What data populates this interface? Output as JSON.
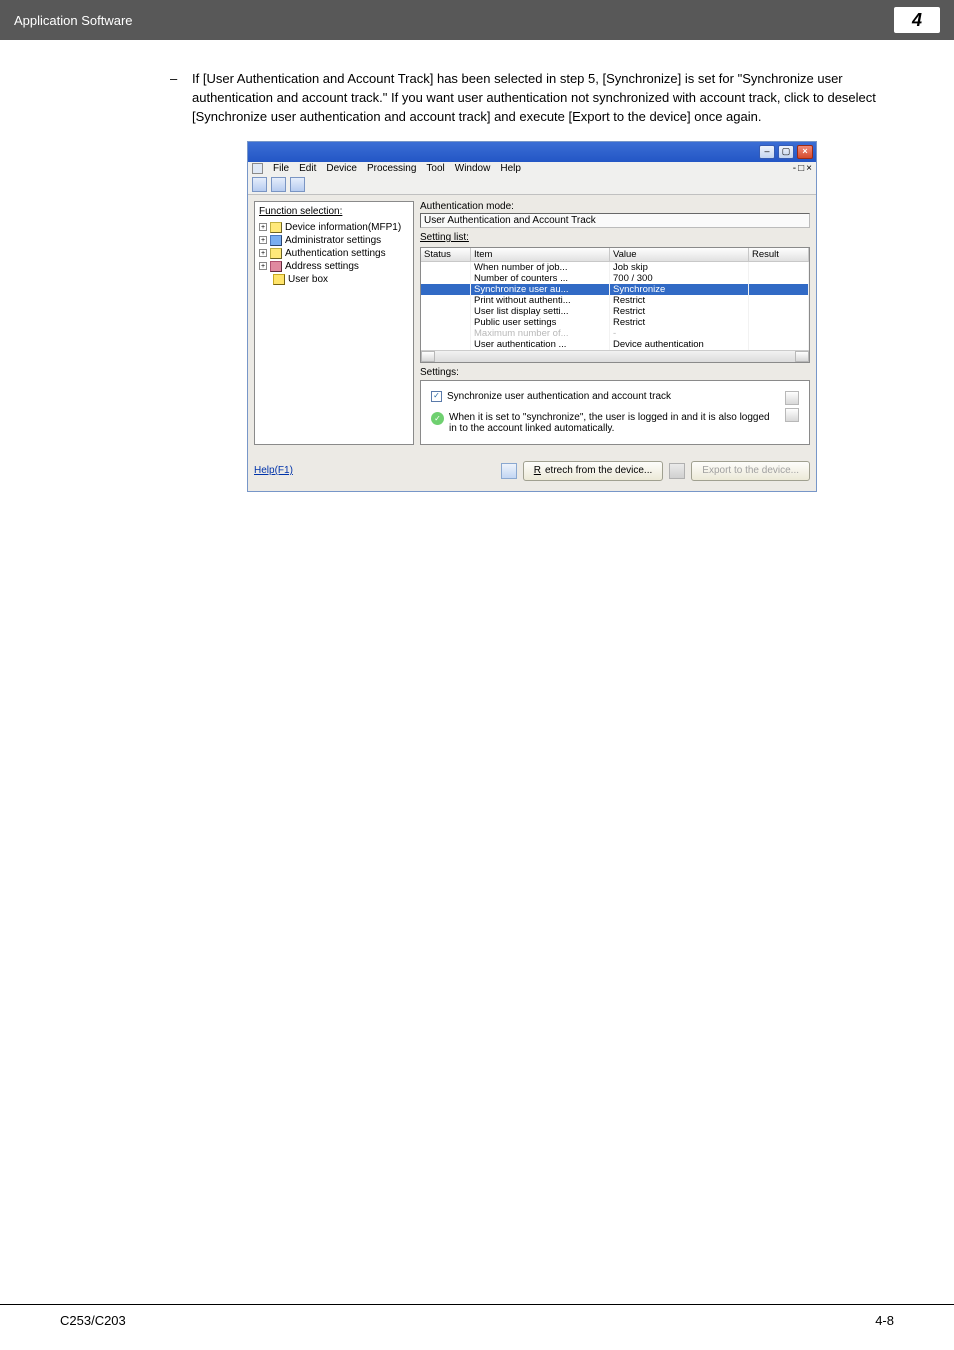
{
  "header": {
    "breadcrumb": "Application Software",
    "chapter": "4"
  },
  "instruction": "If [User Authentication and Account Track] has been selected in step 5, [Synchronize] is set for \"Synchronize user authentication and account track.\" If you want user authentication not synchronized with account track, click to deselect [Synchronize user authentication and account track] and execute [Export to the device] once again.",
  "menus": [
    "File",
    "Edit",
    "Device",
    "Processing",
    "Tool",
    "Window",
    "Help"
  ],
  "tree": {
    "title": "Function selection:",
    "items": [
      "Device information(MFP1)",
      "Administrator settings",
      "Authentication settings",
      "Address settings",
      "User box"
    ]
  },
  "main": {
    "auth_mode_label": "Authentication mode:",
    "auth_mode_value": "User Authentication and Account Track",
    "setting_list_label": "Setting list:",
    "columns": [
      "Status",
      "Item",
      "Value",
      "Result"
    ],
    "rows": [
      {
        "item": "When number of job...",
        "value": "Job skip"
      },
      {
        "item": "Number of counters ...",
        "value": "700 / 300"
      },
      {
        "item": "Synchronize user au...",
        "value": "Synchronize"
      },
      {
        "item": "Print without authenti...",
        "value": "Restrict"
      },
      {
        "item": "User list display setti...",
        "value": "Restrict"
      },
      {
        "item": "Public user settings",
        "value": "Restrict"
      },
      {
        "item": "Maximum number of...",
        "value": "-"
      },
      {
        "item": "User authentication ...",
        "value": "Device authentication"
      }
    ],
    "settings_label": "Settings:",
    "checkbox_label": "Synchronize user authentication and account track",
    "info_text": "When it is set to \"synchronize\", the user is logged in and it is also logged in to the account linked automatically."
  },
  "buttons": {
    "help": "Help(F1)",
    "retrieve_u": "R",
    "retrieve_rest": "etrech from the device...",
    "export": "Export to the device..."
  },
  "footer": {
    "left": "C253/C203",
    "right": "4-8"
  }
}
